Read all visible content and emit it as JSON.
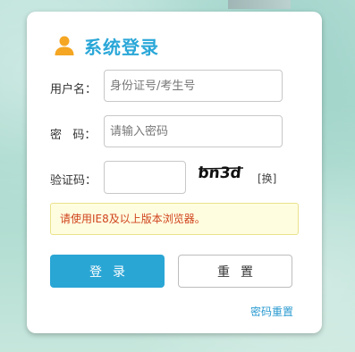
{
  "login": {
    "title": "系统登录",
    "title_icon": "user-icon",
    "accent_color": "#2aa7d8",
    "username": {
      "label": "用户名：",
      "placeholder": "身份证号/考生号",
      "value": ""
    },
    "password": {
      "label": "密   码：",
      "placeholder": "请输入密码",
      "value": ""
    },
    "captcha": {
      "label": "验证码：",
      "value": "",
      "image_text": "bn3d",
      "refresh_label": "[换]"
    },
    "notice": "请使用IE8及以上版本浏览器。",
    "buttons": {
      "login": "登录",
      "reset": "重置"
    },
    "reset_password_link": "密码重置"
  }
}
